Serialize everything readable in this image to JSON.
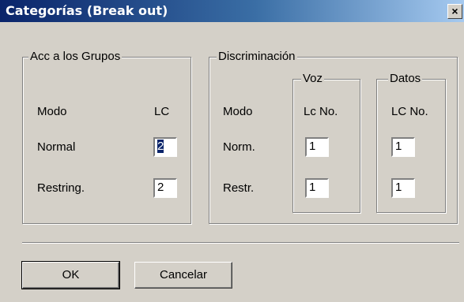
{
  "window": {
    "title": "Categorías (Break out)",
    "close_glyph": "×"
  },
  "acc": {
    "legend": "Acc a los Grupos",
    "modo_label": "Modo",
    "lc_header": "LC",
    "normal_label": "Normal",
    "normal_value": "2",
    "restring_label": "Restring.",
    "restring_value": "2"
  },
  "disc": {
    "legend": "Discriminación",
    "modo_label": "Modo",
    "norm_label": "Norm.",
    "restr_label": "Restr.",
    "voz": {
      "legend": "Voz",
      "header": "Lc No.",
      "norm_value": "1",
      "restr_value": "1"
    },
    "datos": {
      "legend": "Datos",
      "header": "LC No.",
      "norm_value": "1",
      "restr_value": "1"
    }
  },
  "buttons": {
    "ok": "OK",
    "cancel": "Cancelar"
  }
}
